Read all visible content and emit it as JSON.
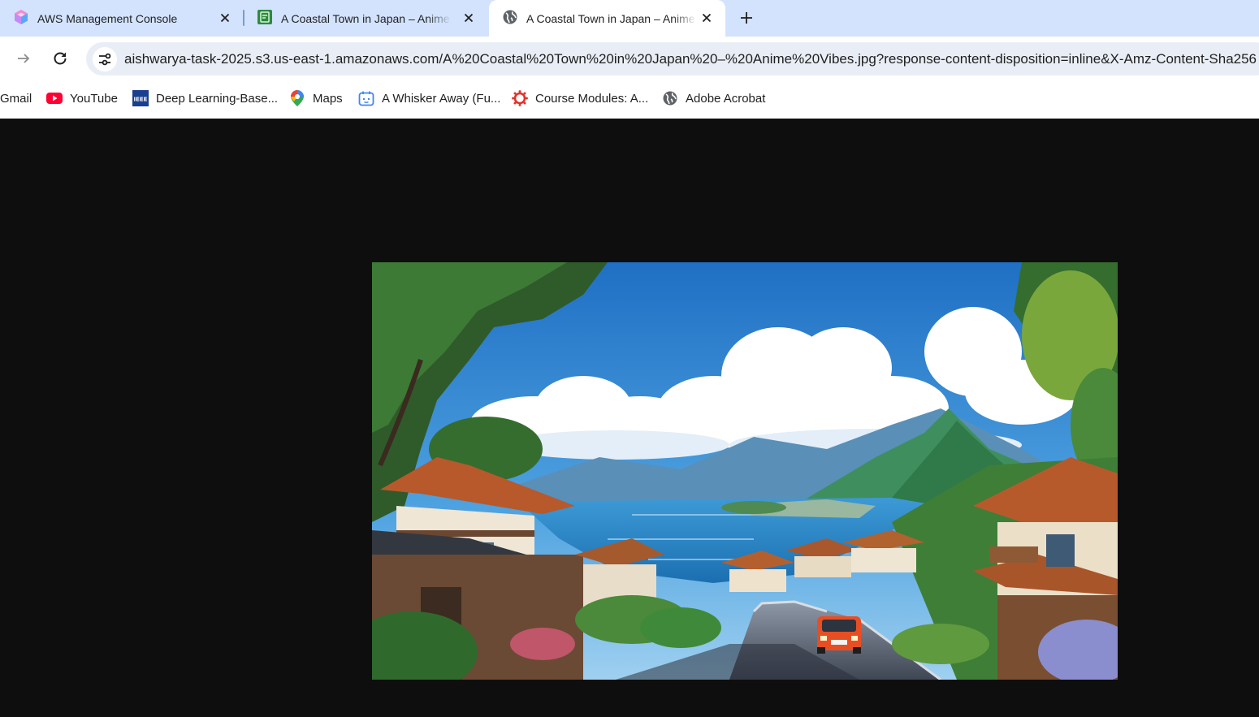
{
  "tabs": [
    {
      "title": "AWS Management Console",
      "icon": "aws-cube-icon",
      "active": false
    },
    {
      "title": "A Coastal Town in Japan – Anime Vibes",
      "icon": "green-doc-icon",
      "active": false
    },
    {
      "title": "A Coastal Town in Japan – Anime Vibes",
      "icon": "globe-icon",
      "active": true
    }
  ],
  "toolbar": {
    "url": "aishwarya-task-2025.s3.us-east-1.amazonaws.com/A%20Coastal%20Town%20in%20Japan%20–%20Anime%20Vibes.jpg?response-content-disposition=inline&X-Amz-Content-Sha256"
  },
  "bookmarks": [
    {
      "label": "Gmail",
      "icon": "gmail-icon"
    },
    {
      "label": "YouTube",
      "icon": "youtube-icon"
    },
    {
      "label": "Deep Learning-Base...",
      "icon": "ieee-icon"
    },
    {
      "label": "Maps",
      "icon": "maps-pin-icon"
    },
    {
      "label": "A Whisker Away (Fu...",
      "icon": "calendar-face-icon"
    },
    {
      "label": "Course Modules: A...",
      "icon": "canvas-icon"
    },
    {
      "label": "Adobe Acrobat",
      "icon": "globe-icon"
    }
  ],
  "colors": {
    "tabstrip": "#d3e3fd",
    "page_background": "#0e0e0e",
    "omnibox": "#e9eef6"
  }
}
